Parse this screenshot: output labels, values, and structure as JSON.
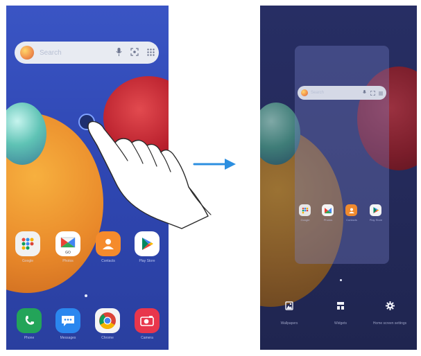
{
  "left_screen": {
    "search": {
      "placeholder": "Search"
    },
    "apps": [
      {
        "name": "folder",
        "label": "Google",
        "color": "#f1f1f1"
      },
      {
        "name": "photos",
        "label": "Photos",
        "color": "#ffffff"
      },
      {
        "name": "contacts",
        "label": "Contacts",
        "color": "#f58b2c"
      },
      {
        "name": "play-store",
        "label": "Play Store",
        "color": "#ffffff"
      }
    ],
    "dock": [
      {
        "name": "phone",
        "label": "Phone",
        "color": "#23a459"
      },
      {
        "name": "messages",
        "label": "Messages",
        "color": "#2b87ef"
      },
      {
        "name": "chrome",
        "label": "Chrome",
        "color": "#f4f4f4"
      },
      {
        "name": "camera",
        "label": "Camera",
        "color": "#e8364c"
      }
    ],
    "photos_badge": "GO"
  },
  "arrow": {
    "color": "#2c8fe0"
  },
  "right_screen": {
    "search": {
      "placeholder": "Search"
    },
    "apps": [
      {
        "name": "folder",
        "label": "Google"
      },
      {
        "name": "photos",
        "label": "Photos"
      },
      {
        "name": "contacts",
        "label": "Contacts"
      },
      {
        "name": "play-store",
        "label": "Play Store"
      }
    ],
    "bottom_bar": [
      {
        "name": "wallpapers",
        "label": "Wallpapers",
        "symbol": "▞"
      },
      {
        "name": "widgets",
        "label": "Widgets",
        "symbol": "▦"
      },
      {
        "name": "home-screen-settings",
        "label": "Home screen settings",
        "symbol": "⚙"
      }
    ]
  }
}
